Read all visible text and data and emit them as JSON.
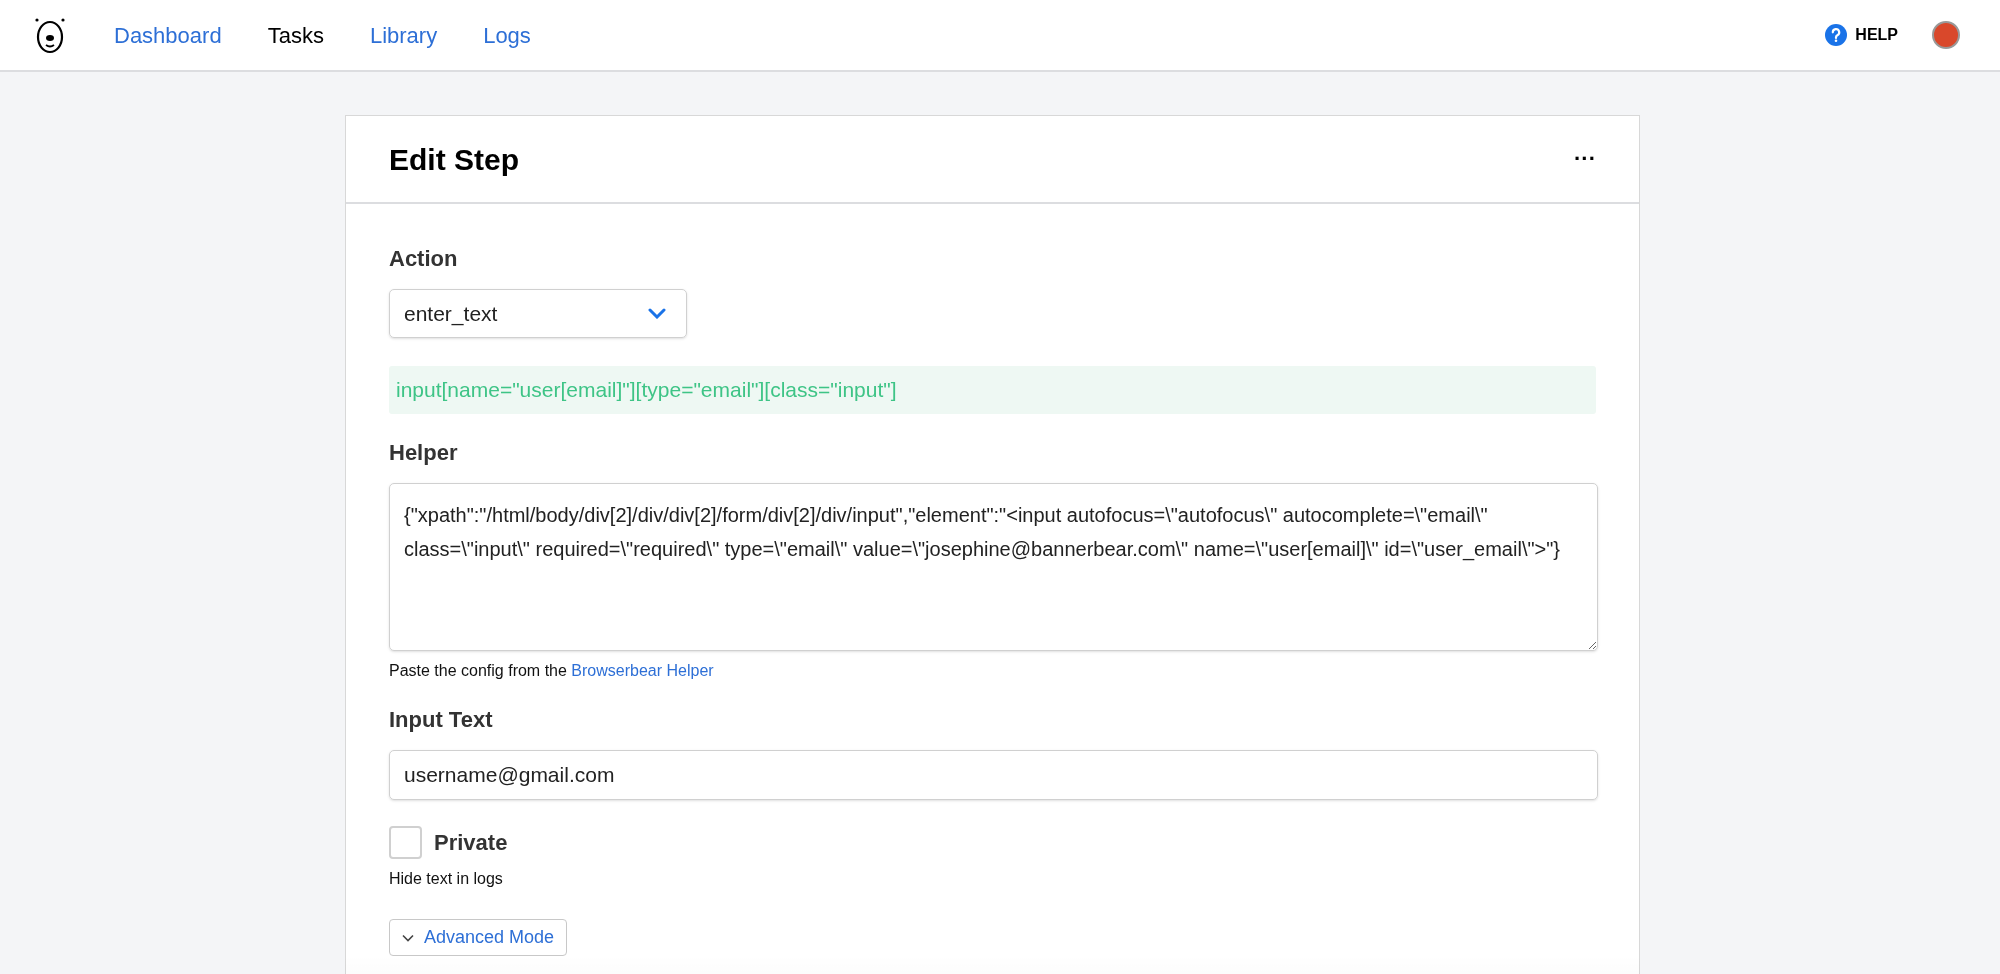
{
  "nav": {
    "items": [
      {
        "label": "Dashboard",
        "selected": false
      },
      {
        "label": "Tasks",
        "selected": true
      },
      {
        "label": "Library",
        "selected": false
      },
      {
        "label": "Logs",
        "selected": false
      }
    ],
    "help": "HELP"
  },
  "card": {
    "title": "Edit Step",
    "menu": "···",
    "action": {
      "label": "Action",
      "value": "enter_text"
    },
    "selector": "input[name=\"user[email]\"][type=\"email\"][class=\"input\"]",
    "helper": {
      "label": "Helper",
      "value": "{\"xpath\":\"/html/body/div[2]/div/div[2]/form/div[2]/div/input\",\"element\":\"<input autofocus=\\\"autofocus\\\" autocomplete=\\\"email\\\" class=\\\"input\\\" required=\\\"required\\\" type=\\\"email\\\" value=\\\"josephine@bannerbear.com\\\" name=\\\"user[email]\\\" id=\\\"user_email\\\">\"}",
      "hint": "Paste the config from the",
      "hint_link": "Browserbear Helper"
    },
    "input_text": {
      "label": "Input Text",
      "value": "username@gmail.com"
    },
    "private": {
      "label": "Private",
      "checked": false,
      "hint": "Hide text in logs"
    },
    "advanced": "Advanced Mode"
  }
}
